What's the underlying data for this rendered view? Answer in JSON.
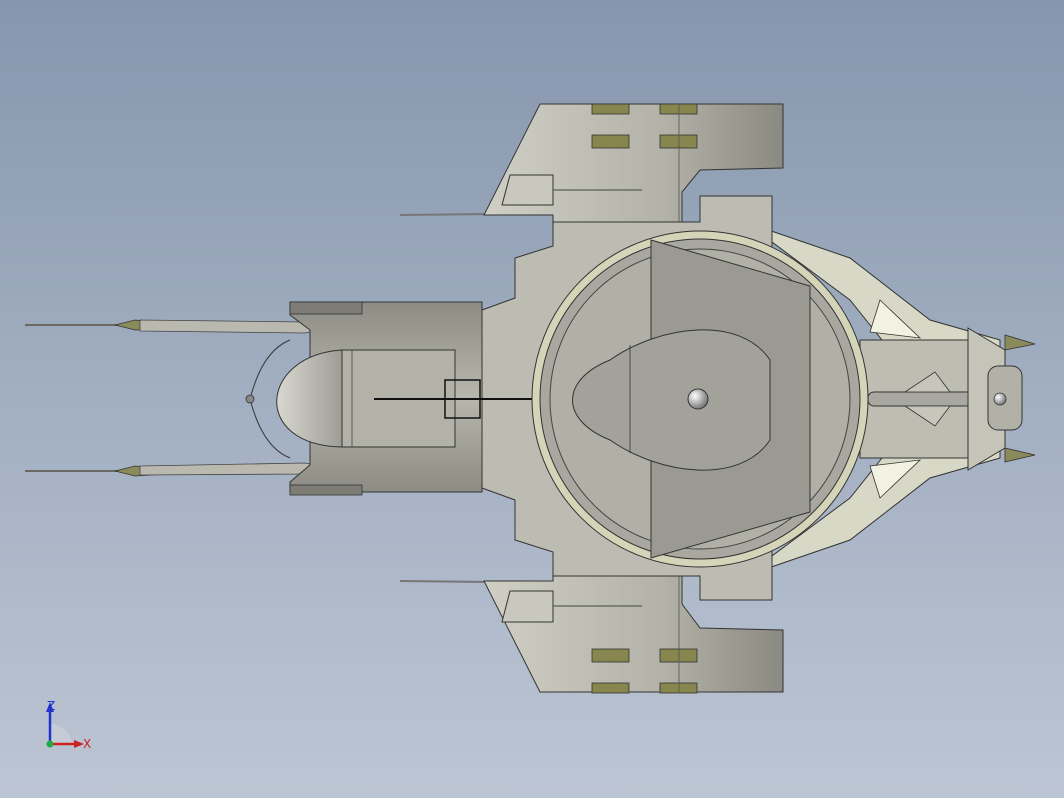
{
  "viewport": {
    "background_top": "#8796ad",
    "background_bottom": "#bcc5d3"
  },
  "model": {
    "view": "top",
    "body_color": "#a3a39b",
    "hull_light": "#cfcfc4",
    "hull_dark": "#85857d",
    "accent_color": "#e6e6c8",
    "panel_color": "#86864e",
    "edge_color": "#2a2a2a"
  },
  "triad": {
    "z_label": "Z",
    "x_label": "X",
    "z_color": "#2233cc",
    "x_color": "#cc2222",
    "origin_color": "#22aa44",
    "icon": "coordinate-axes-icon"
  }
}
